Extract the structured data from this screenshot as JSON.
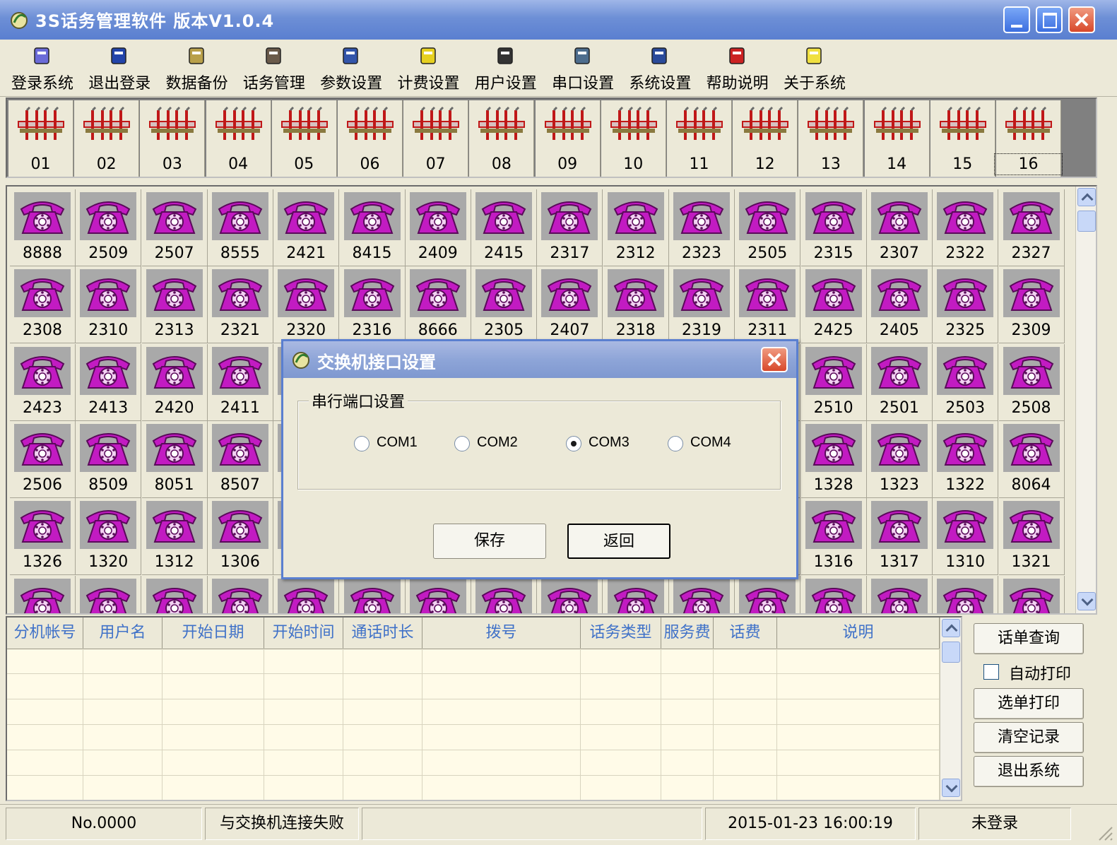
{
  "window": {
    "title": "3S话务管理软件 版本V1.0.4"
  },
  "toolbar": {
    "items": [
      {
        "label": "登录系统",
        "icon": "login-icon"
      },
      {
        "label": "退出登录",
        "icon": "logout-icon"
      },
      {
        "label": "数据备份",
        "icon": "backup-icon"
      },
      {
        "label": "话务管理",
        "icon": "call-management-icon"
      },
      {
        "label": "参数设置",
        "icon": "parameter-settings-icon"
      },
      {
        "label": "计费设置",
        "icon": "billing-settings-icon"
      },
      {
        "label": "用户设置",
        "icon": "user-settings-icon"
      },
      {
        "label": "串口设置",
        "icon": "serial-port-icon"
      },
      {
        "label": "系统设置",
        "icon": "system-settings-icon"
      },
      {
        "label": "帮助说明",
        "icon": "help-icon"
      },
      {
        "label": "关于系统",
        "icon": "about-icon"
      }
    ]
  },
  "trunks": [
    "01",
    "02",
    "03",
    "04",
    "05",
    "06",
    "07",
    "08",
    "09",
    "10",
    "11",
    "12",
    "13",
    "14",
    "15",
    "16"
  ],
  "extensions": [
    [
      "8888",
      "2509",
      "2507",
      "8555",
      "2421",
      "8415",
      "2409",
      "2415",
      "2317",
      "2312",
      "2323",
      "2505",
      "2315",
      "2307",
      "2322",
      "2327"
    ],
    [
      "2308",
      "2310",
      "2313",
      "2321",
      "2320",
      "2316",
      "8666",
      "2305",
      "2407",
      "2318",
      "2319",
      "2311",
      "2425",
      "2405",
      "2325",
      "2309"
    ],
    [
      "2423",
      "2413",
      "2420",
      "2411",
      "",
      "",
      "",
      "",
      "",
      "",
      "",
      "",
      "2510",
      "2501",
      "2503",
      "2508"
    ],
    [
      "2506",
      "8509",
      "8051",
      "8507",
      "",
      "",
      "",
      "",
      "",
      "",
      "",
      "",
      "1328",
      "1323",
      "1322",
      "8064"
    ],
    [
      "1326",
      "1320",
      "1312",
      "1306",
      "",
      "",
      "",
      "",
      "",
      "",
      "",
      "",
      "1316",
      "1317",
      "1310",
      "1321"
    ],
    [
      "",
      "",
      "",
      "",
      "",
      "",
      "",
      "",
      "",
      "",
      "",
      "",
      "",
      "",
      "",
      ""
    ]
  ],
  "records": {
    "columns": [
      "分机帐号",
      "用户名",
      "开始日期",
      "开始时间",
      "通话时长",
      "拨号",
      "话务类型",
      "服务费",
      "话费",
      "说明"
    ],
    "rows": []
  },
  "side_buttons": {
    "query": "话单查询",
    "auto_print": "自动打印",
    "auto_print_checked": false,
    "select_print": "选单打印",
    "clear": "清空记录",
    "exit": "退出系统"
  },
  "status": {
    "number": "No.0000",
    "connection": "与交换机连接失败",
    "blank": "",
    "datetime": "2015-01-23 16:00:19",
    "login": "未登录"
  },
  "dialog": {
    "title": "交换机接口设置",
    "group": "串行端口设置",
    "ports": [
      "COM1",
      "COM2",
      "COM3",
      "COM4"
    ],
    "selected_port": "COM3",
    "save": "保存",
    "back": "返回"
  },
  "colors": {
    "titlebar": "#6d8fd6",
    "phone": "#c21bc2",
    "header_text": "#3f71c8",
    "table_bg": "#fffbe8"
  }
}
